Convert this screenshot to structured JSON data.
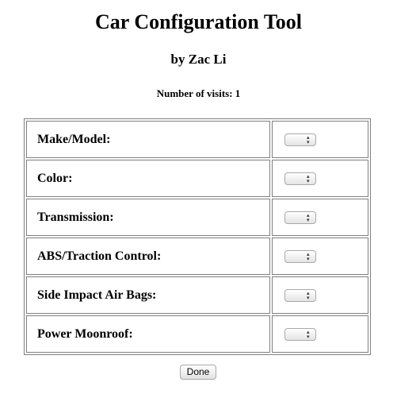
{
  "header": {
    "title": "Car Configuration Tool",
    "byline": "by Zac Li",
    "visits": "Number of visits: 1"
  },
  "options": [
    {
      "label": "Make/Model:",
      "selected": ""
    },
    {
      "label": "Color:",
      "selected": ""
    },
    {
      "label": "Transmission:",
      "selected": ""
    },
    {
      "label": "ABS/Traction Control:",
      "selected": ""
    },
    {
      "label": "Side Impact Air Bags:",
      "selected": ""
    },
    {
      "label": "Power Moonroof:",
      "selected": ""
    }
  ],
  "footer": {
    "done_label": "Done"
  },
  "icons": {
    "select_arrows": "updown-chevron-icon"
  }
}
